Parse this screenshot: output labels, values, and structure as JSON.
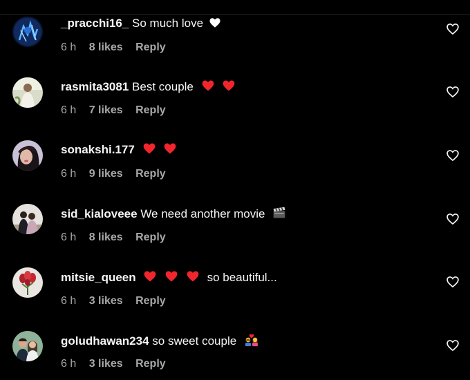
{
  "comments": [
    {
      "username": "_pracchi16_",
      "text": "So much love",
      "emojis": [
        "white-heart"
      ],
      "time": "6 h",
      "likes": "8 likes",
      "reply": "Reply"
    },
    {
      "username": "rasmita3081",
      "text": "Best couple",
      "emojis": [
        "red-heart",
        "red-heart"
      ],
      "time": "6 h",
      "likes": "7 likes",
      "reply": "Reply"
    },
    {
      "username": "sonakshi.177",
      "text": "",
      "emojis": [
        "red-heart",
        "red-heart"
      ],
      "time": "6 h",
      "likes": "9 likes",
      "reply": "Reply"
    },
    {
      "username": "sid_kialoveee",
      "text": "We need another movie",
      "emojis": [
        "clapper-board"
      ],
      "time": "6 h",
      "likes": "8 likes",
      "reply": "Reply"
    },
    {
      "username": "mitsie_queen",
      "text": "so beautiful...",
      "emojis_before_text": [
        "red-heart",
        "red-heart",
        "red-heart"
      ],
      "time": "6 h",
      "likes": "3 likes",
      "reply": "Reply"
    },
    {
      "username": "goludhawan234",
      "text": "so sweet couple",
      "emojis": [
        "couple-with-heart"
      ],
      "time": "6 h",
      "likes": "3 likes",
      "reply": "Reply"
    }
  ],
  "colors": {
    "background": "#000000",
    "primary_text": "#f5f5f5",
    "secondary_text": "#a8a8a8",
    "heart_red": "#ff3040"
  }
}
